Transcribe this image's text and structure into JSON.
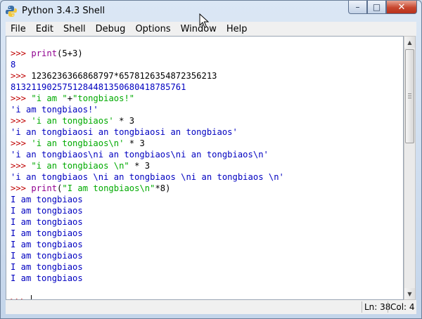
{
  "window": {
    "title": "Python 3.4.3 Shell"
  },
  "controls": {
    "minimize": "–",
    "maximize": "□",
    "close": "✕"
  },
  "menu": [
    "File",
    "Edit",
    "Shell",
    "Debug",
    "Options",
    "Window",
    "Help"
  ],
  "shell": {
    "lines": [
      [
        {
          "c": "prompt",
          "t": ">>> "
        },
        {
          "c": "builtin",
          "t": "print"
        },
        {
          "c": "def",
          "t": "(5+3)"
        }
      ],
      [
        {
          "c": "out",
          "t": "8"
        }
      ],
      [
        {
          "c": "prompt",
          "t": ">>> "
        },
        {
          "c": "def",
          "t": "1236236366868797*6578126354872356213"
        }
      ],
      [
        {
          "c": "out",
          "t": "8132119025751284481350680418785761"
        }
      ],
      [
        {
          "c": "prompt",
          "t": ">>> "
        },
        {
          "c": "str",
          "t": "\"i am \""
        },
        {
          "c": "def",
          "t": "+"
        },
        {
          "c": "str",
          "t": "\"tongbiaos!\""
        }
      ],
      [
        {
          "c": "out",
          "t": "'i am tongbiaos!'"
        }
      ],
      [
        {
          "c": "prompt",
          "t": ">>> "
        },
        {
          "c": "str",
          "t": "'i an tongbiaos'"
        },
        {
          "c": "def",
          "t": " * 3"
        }
      ],
      [
        {
          "c": "out",
          "t": "'i an tongbiaosi an tongbiaosi an tongbiaos'"
        }
      ],
      [
        {
          "c": "prompt",
          "t": ">>> "
        },
        {
          "c": "str",
          "t": "'i an tongbiaos\\n'"
        },
        {
          "c": "def",
          "t": " * 3"
        }
      ],
      [
        {
          "c": "out",
          "t": "'i an tongbiaos\\ni an tongbiaos\\ni an tongbiaos\\n'"
        }
      ],
      [
        {
          "c": "prompt",
          "t": ">>> "
        },
        {
          "c": "str",
          "t": "\"i an tongbiaos \\n\""
        },
        {
          "c": "def",
          "t": " * 3"
        }
      ],
      [
        {
          "c": "out",
          "t": "'i an tongbiaos \\ni an tongbiaos \\ni an tongbiaos \\n'"
        }
      ],
      [
        {
          "c": "prompt",
          "t": ">>> "
        },
        {
          "c": "builtin",
          "t": "print"
        },
        {
          "c": "def",
          "t": "("
        },
        {
          "c": "str",
          "t": "\"I am tongbiaos\\n\""
        },
        {
          "c": "def",
          "t": "*8)"
        }
      ],
      [
        {
          "c": "out",
          "t": "I am tongbiaos"
        }
      ],
      [
        {
          "c": "out",
          "t": "I am tongbiaos"
        }
      ],
      [
        {
          "c": "out",
          "t": "I am tongbiaos"
        }
      ],
      [
        {
          "c": "out",
          "t": "I am tongbiaos"
        }
      ],
      [
        {
          "c": "out",
          "t": "I am tongbiaos"
        }
      ],
      [
        {
          "c": "out",
          "t": "I am tongbiaos"
        }
      ],
      [
        {
          "c": "out",
          "t": "I am tongbiaos"
        }
      ],
      [
        {
          "c": "out",
          "t": "I am tongbiaos"
        }
      ],
      [],
      [
        {
          "c": "prompt",
          "t": ">>> "
        }
      ]
    ]
  },
  "status": {
    "line": "Ln: 38",
    "col": "Col: 4"
  },
  "colors": {
    "prompt": "#c00000",
    "builtin": "#900090",
    "string": "#00aa00",
    "output": "#0000c0"
  }
}
